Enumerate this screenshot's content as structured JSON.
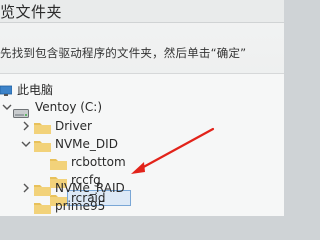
{
  "window": {
    "title": "览文件夹"
  },
  "dialog": {
    "instruction": "先找到包含驱动程序的文件夹，然后单击“确定”"
  },
  "tree": {
    "this_pc": "此电脑",
    "ventoy": "Ventoy (C:)",
    "driver": "Driver",
    "nvme_did": "NVMe_DID",
    "rcbottom": "rcbottom",
    "rccfg": "rccfg",
    "rcraid": "rcraid",
    "nvme_raid": "NVMe_RAID",
    "prime95": "prime95"
  },
  "colors": {
    "folder": "#e8c15a",
    "selection": "#dde9f6",
    "annotation_arrow": "#e2231a"
  },
  "annotation": {
    "icon": "red-arrow"
  }
}
